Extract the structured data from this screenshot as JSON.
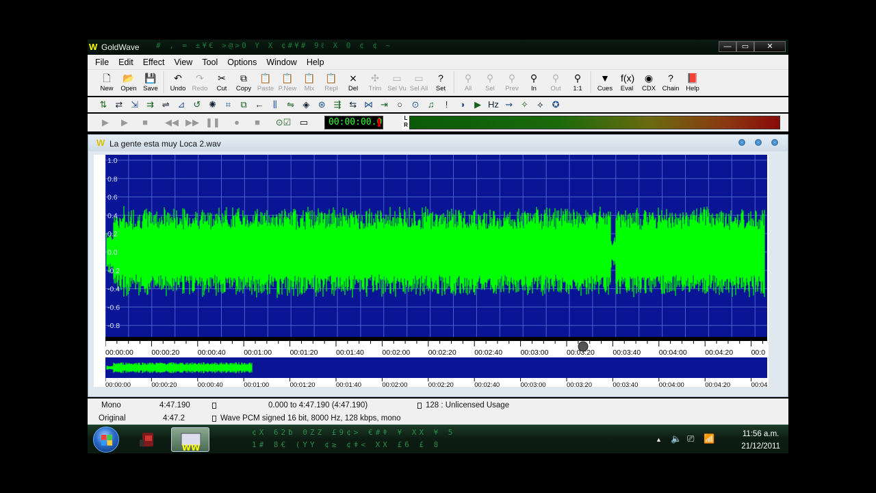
{
  "window": {
    "title": "GoldWave",
    "logo": "W",
    "matrix_text": "#  ,   =  ±¥€  >@>0  Y  X  ¢#¥#  9ℓ X  0  ¢  ¢  ~",
    "minimize": "—",
    "maximize": "▭",
    "close": "✕"
  },
  "menu": [
    "File",
    "Edit",
    "Effect",
    "View",
    "Tool",
    "Options",
    "Window",
    "Help"
  ],
  "toolbar_main": [
    {
      "label": "New",
      "icon": "new-icon",
      "glyph": "🗋",
      "enabled": true
    },
    {
      "label": "Open",
      "icon": "open-icon",
      "glyph": "📂",
      "enabled": true
    },
    {
      "label": "Save",
      "icon": "save-icon",
      "glyph": "💾",
      "enabled": true
    },
    {
      "sep": true
    },
    {
      "label": "Undo",
      "icon": "undo-icon",
      "glyph": "↶",
      "enabled": true
    },
    {
      "label": "Redo",
      "icon": "redo-icon",
      "glyph": "↷",
      "enabled": false
    },
    {
      "label": "Cut",
      "icon": "cut-icon",
      "glyph": "✂",
      "enabled": true
    },
    {
      "label": "Copy",
      "icon": "copy-icon",
      "glyph": "⧉",
      "enabled": true
    },
    {
      "label": "Paste",
      "icon": "paste-icon",
      "glyph": "📋",
      "enabled": false
    },
    {
      "label": "P.New",
      "icon": "paste-new-icon",
      "glyph": "📋",
      "enabled": false
    },
    {
      "label": "Mix",
      "icon": "mix-icon",
      "glyph": "📋",
      "enabled": false
    },
    {
      "label": "Repl",
      "icon": "replace-icon",
      "glyph": "📋",
      "enabled": false
    },
    {
      "label": "Del",
      "icon": "delete-icon",
      "glyph": "⨯",
      "enabled": true
    },
    {
      "label": "Trim",
      "icon": "trim-icon",
      "glyph": "✣",
      "enabled": false
    },
    {
      "label": "Sel Vu",
      "icon": "select-view-icon",
      "glyph": "▭",
      "enabled": false
    },
    {
      "label": "Sel All",
      "icon": "select-all-icon",
      "glyph": "▭",
      "enabled": false
    },
    {
      "label": "Set",
      "icon": "set-icon",
      "glyph": "?",
      "enabled": true
    },
    {
      "sep": true
    },
    {
      "label": "All",
      "icon": "zoom-all-icon",
      "glyph": "⚲",
      "enabled": false
    },
    {
      "label": "Sel",
      "icon": "zoom-selection-icon",
      "glyph": "⚲",
      "enabled": false
    },
    {
      "label": "Prev",
      "icon": "zoom-previous-icon",
      "glyph": "⚲",
      "enabled": false
    },
    {
      "label": "In",
      "icon": "zoom-in-icon",
      "glyph": "⚲",
      "enabled": true
    },
    {
      "label": "Out",
      "icon": "zoom-out-icon",
      "glyph": "⚲",
      "enabled": false
    },
    {
      "label": "1:1",
      "icon": "zoom-1to1-icon",
      "glyph": "⚲",
      "enabled": true
    },
    {
      "sep": true
    },
    {
      "label": "Cues",
      "icon": "cues-icon",
      "glyph": "▼",
      "enabled": true
    },
    {
      "label": "Eval",
      "icon": "eval-icon",
      "glyph": "f(x)",
      "enabled": true
    },
    {
      "label": "CDX",
      "icon": "cd-extract-icon",
      "glyph": "◉",
      "enabled": true
    },
    {
      "label": "Chain",
      "icon": "chain-icon",
      "glyph": "?",
      "enabled": true
    },
    {
      "label": "Help",
      "icon": "help-icon",
      "glyph": "📕",
      "enabled": true
    }
  ],
  "effects_toolbar": [
    "⇅",
    "⇄",
    "⇲",
    "⇉",
    "⇌",
    "⊿",
    "↺",
    "✺",
    "⌗",
    "⧉",
    "←",
    "⫼",
    "⇋",
    "◈",
    "⊛",
    "⇶",
    "⇆",
    "⋈",
    "⇥",
    "○",
    "⊙",
    "♫",
    "!",
    "◑",
    "▶",
    "Hz",
    "⇝",
    "✧",
    "⟡",
    "✪"
  ],
  "transport": {
    "time": "00:00:00.0",
    "lr_left": "L",
    "lr_right": "R"
  },
  "sound_window": {
    "title": "La gente esta muy Loca 2.wav",
    "icon": "W",
    "y_ticks": [
      "1.0",
      "0.8",
      "0.6",
      "0.4",
      "0.2",
      "0.0",
      "-0.2",
      "-0.4",
      "-0.6",
      "-0.8"
    ],
    "time_ticks": [
      "00:00:00",
      "00:00:20",
      "00:00:40",
      "00:01:00",
      "00:01:20",
      "00:01:40",
      "00:02:00",
      "00:02:20",
      "00:02:40",
      "00:03:00",
      "00:03:20",
      "00:03:40",
      "00:04:00",
      "00:04:20",
      "00:0"
    ],
    "overview_ticks": [
      "00:00:00",
      "00:00:20",
      "00:00:40",
      "00:01:00",
      "00:01:20",
      "00:01:40",
      "00:02:00",
      "00:02:20",
      "00:02:40",
      "00:03:00",
      "00:03:20",
      "00:03:40",
      "00:04:00",
      "00:04:20",
      "00:04"
    ],
    "colors": {
      "background": "#0a1596",
      "waveform": "#00ff00",
      "grid": "#4a63c8"
    }
  },
  "status": {
    "channels": "Mono",
    "length": "4:47.190",
    "selection": "0.000 to 4:47.190 (4:47.190)",
    "license": "128 : Unlicensed Usage",
    "original_label": "Original",
    "original_length": "4:47.2",
    "format": "Wave PCM signed 16 bit, 8000 Hz, 128 kbps, mono"
  },
  "taskbar": {
    "matrix_text": "¢X  62ƀ  0ZZ  £9¢>  €#ǂ  ¥  XX  ¥  5",
    "matrix_text2": "1#  8€  (YY  ¢≥  ¢ǂ<  XX  £6   £  8",
    "time": "11:56 a.m.",
    "date": "21/12/2011",
    "tray_icons": [
      "▲",
      "🔈",
      "⎚",
      "📶"
    ]
  }
}
